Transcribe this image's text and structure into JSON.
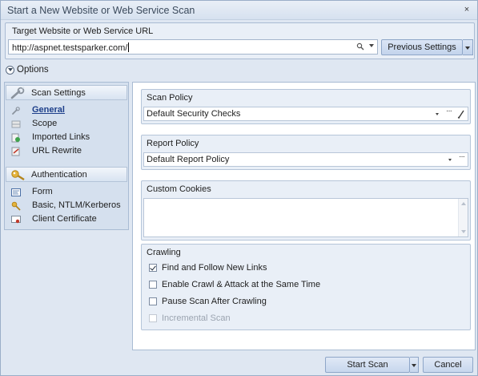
{
  "window": {
    "title": "Start a New Website or Web Service Scan",
    "close_label": "×"
  },
  "target": {
    "label": "Target Website or Web Service URL",
    "url_value": "http://aspnet.testsparker.com/",
    "previous_settings_label": "Previous Settings"
  },
  "options": {
    "label": "Options"
  },
  "sidebar": {
    "sections": [
      {
        "header": "Scan Settings",
        "icon": "wrench-icon",
        "items": [
          {
            "label": "General",
            "icon": "wrench-small-icon",
            "active": true
          },
          {
            "label": "Scope",
            "icon": "scope-icon",
            "active": false
          },
          {
            "label": "Imported Links",
            "icon": "link-icon",
            "active": false
          },
          {
            "label": "URL Rewrite",
            "icon": "rewrite-icon",
            "active": false
          }
        ]
      },
      {
        "header": "Authentication",
        "icon": "key-icon",
        "items": [
          {
            "label": "Form",
            "icon": "form-icon",
            "active": false
          },
          {
            "label": "Basic, NTLM/Kerberos",
            "icon": "key-small-icon",
            "active": false
          },
          {
            "label": "Client Certificate",
            "icon": "certificate-icon",
            "active": false
          }
        ]
      }
    ]
  },
  "main": {
    "scan_policy": {
      "title": "Scan Policy",
      "value": "Default Security Checks",
      "more_label": "···"
    },
    "report_policy": {
      "title": "Report Policy",
      "value": "Default Report Policy",
      "more_label": "···"
    },
    "custom_cookies": {
      "title": "Custom Cookies",
      "value": ""
    },
    "crawling": {
      "title": "Crawling",
      "options": [
        {
          "label": "Find and Follow New Links",
          "checked": true,
          "disabled": false
        },
        {
          "label": "Enable Crawl & Attack at the Same Time",
          "checked": false,
          "disabled": false
        },
        {
          "label": "Pause Scan After Crawling",
          "checked": false,
          "disabled": false
        },
        {
          "label": "Incremental Scan",
          "checked": false,
          "disabled": true
        }
      ]
    }
  },
  "footer": {
    "start_scan_label": "Start Scan",
    "cancel_label": "Cancel"
  },
  "colors": {
    "window_bg": "#dfe7f2",
    "group_bg": "#e9eff7",
    "active_link": "#1d3f8a",
    "border": "#a9bbd3"
  }
}
